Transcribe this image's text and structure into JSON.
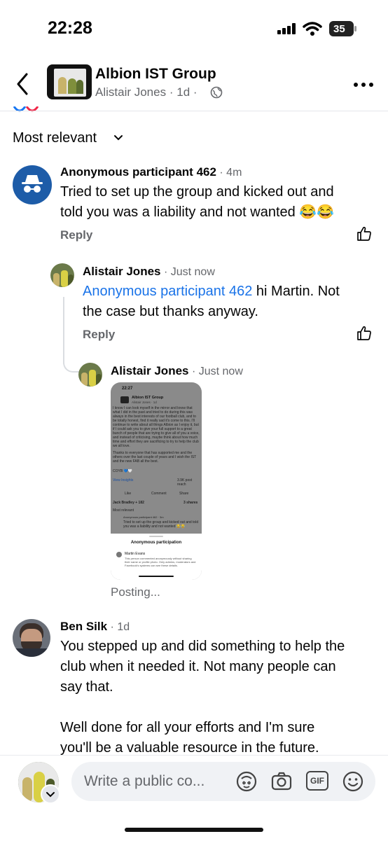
{
  "status": {
    "time": "22:28",
    "battery": "35"
  },
  "header": {
    "group_name": "Albion IST Group",
    "author": "Alistair Jones",
    "age": "1d"
  },
  "sort_label": "Most relevant",
  "comments": [
    {
      "name": "Anonymous participant 462",
      "time": "4m",
      "text_line1": "Tried to set up the group and kicked out and",
      "text_line2": "told you was a liability and not wanted 😂😂",
      "reply": "Reply"
    },
    {
      "name": "Alistair Jones",
      "time": "Just now",
      "mention": "Anonymous participant 462",
      "text_after_mention": " hi Martin. Not",
      "text_line2": "the case but thanks anyway.",
      "reply": "Reply"
    },
    {
      "name": "Alistair Jones",
      "time": "Just now",
      "status": "Posting...",
      "attachment": {
        "time": "22:27",
        "group": "Albion IST Group",
        "author": "Alistair Jones · 1d",
        "body": "I know I can look myself in the mirror and know that what I did in the past and tried to do during this was always in the best interests of our football club, and to be totally honest, find it really sad it's come to this. I'll continue to write about all things Albion as I enjoy it, but if I could ask you to give your full support to a great bunch of people that are trying to give all of you a voice, and instead of criticising, maybe think about how much time and effort they are sacrificing to try to help the club we all love.",
        "body2": "Thanks to everyone that has supported me and the others over the last couple of years and I wish the IST and the new FAB all the best.",
        "coyb": "COYB 💙🤍",
        "insights": "View Insights",
        "reach": "3.9K post reach",
        "like": "Like",
        "comment": "Comment",
        "share": "Share",
        "reactors": "Jack Bradley + 182",
        "shares": "3 shares",
        "sort": "Most relevant",
        "anon": "Anonymous participant 462 · 3m",
        "anon_text": "Tried to set up the group and kicked out and told you was a liability and not wanted 😂😂",
        "sheet_title": "Anonymous participation",
        "sheet_name": "Martin Evans",
        "sheet_text": "This person commented anonymously without sharing their name or profile photo. Only admins, moderators and Facebook's systems can see these details."
      }
    },
    {
      "name": "Ben Silk",
      "time": "1d",
      "line1": "You stepped up and did something to help the",
      "line2": "club when it needed it. Not many people can",
      "line3": "say that.",
      "line4": "Well done for all your efforts and I'm sure",
      "line5": "you'll be a valuable resource in the future."
    }
  ],
  "composer": {
    "placeholder": "Write a public co..."
  },
  "icons": [
    "back-icon",
    "more-icon",
    "globe-icon",
    "chevron-down-icon",
    "incognito-icon",
    "like-icon",
    "avatar-sticker-icon",
    "camera-icon",
    "gif-icon",
    "emoji-icon"
  ],
  "colors": {
    "link": "#1a73e8",
    "anon_bg": "#1d5ca8",
    "secondary_text": "#65676b"
  }
}
